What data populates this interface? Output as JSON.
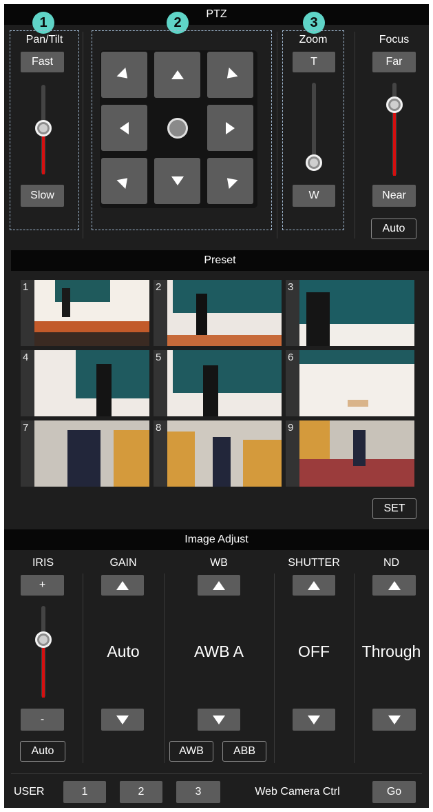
{
  "ptz": {
    "title": "PTZ",
    "badges": [
      "1",
      "2",
      "3"
    ],
    "pan_tilt": {
      "label": "Pan/Tilt",
      "fast": "Fast",
      "slow": "Slow",
      "level": 0.55
    },
    "zoom": {
      "label": "Zoom",
      "tele": "T",
      "wide": "W",
      "level": 0.05
    },
    "focus": {
      "label": "Focus",
      "far": "Far",
      "near": "Near",
      "auto": "Auto",
      "level": 0.82
    }
  },
  "preset": {
    "title": "Preset",
    "numbers": [
      "1",
      "2",
      "3",
      "4",
      "5",
      "6",
      "7",
      "8",
      "9"
    ],
    "set": "SET"
  },
  "image_adjust": {
    "title": "Image Adjust",
    "iris": {
      "label": "IRIS",
      "plus": "+",
      "minus": "-",
      "auto": "Auto",
      "level": 0.6
    },
    "gain": {
      "label": "GAIN",
      "value": "Auto"
    },
    "wb": {
      "label": "WB",
      "value": "AWB A",
      "awb": "AWB",
      "abb": "ABB"
    },
    "shutter": {
      "label": "SHUTTER",
      "value": "OFF"
    },
    "nd": {
      "label": "ND",
      "value": "Through"
    }
  },
  "footer": {
    "user_label": "USER",
    "user_buttons": [
      "1",
      "2",
      "3"
    ],
    "web_ctrl_label": "Web Camera Ctrl",
    "go": "Go"
  },
  "colors": {
    "badge": "#5fd4c7",
    "slider_fill": "#d50f0f",
    "button": "#5c5c5c",
    "panel": "#1e1e1e",
    "header": "#070707"
  }
}
